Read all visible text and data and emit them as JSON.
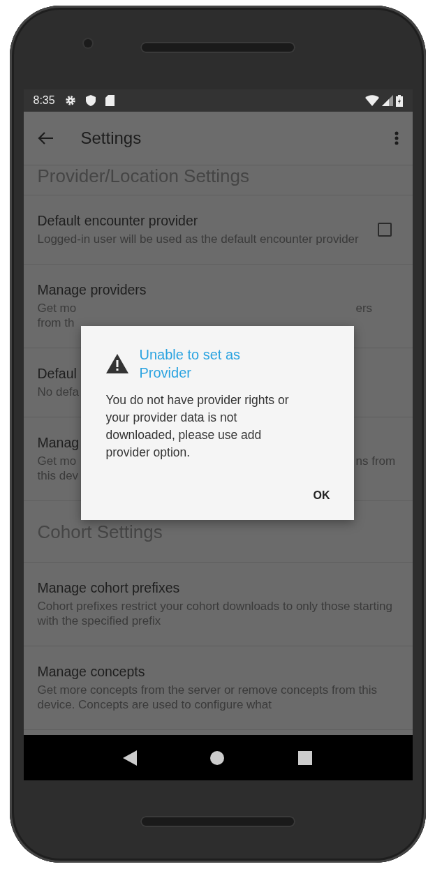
{
  "status_bar": {
    "time": "8:35"
  },
  "toolbar": {
    "title": "Settings"
  },
  "items": [
    {
      "kind": "header",
      "title": "Provider/Location Settings"
    },
    {
      "kind": "checkbox",
      "title": "Default encounter provider",
      "summary": "Logged-in user will be used as the default encounter provider",
      "checked": false
    },
    {
      "kind": "partial",
      "title": "Manage providers",
      "lines": [
        {
          "left": "Get mo",
          "right": "ers"
        },
        {
          "left": "from th"
        }
      ]
    },
    {
      "kind": "partial",
      "title": "Defaul",
      "lines": [
        {
          "left": "No defa"
        }
      ]
    },
    {
      "kind": "partial",
      "title": "Manag",
      "lines": [
        {
          "left": "Get mo",
          "right": "ns from"
        },
        {
          "left": "this dev"
        }
      ]
    },
    {
      "kind": "header",
      "title": "Cohort Settings"
    },
    {
      "kind": "text",
      "title": "Manage cohort prefixes",
      "summary": "Cohort prefixes restrict your cohort downloads to only those starting with the specified prefix"
    },
    {
      "kind": "text",
      "title": "Manage concepts",
      "summary": "Get more concepts from the server or remove concepts from this device. Concepts are used to configure what"
    }
  ],
  "dialog": {
    "title": "Unable to set as Provider",
    "message": "You do not have provider rights or your provider data is not downloaded, please use add provider option.",
    "button": "OK"
  }
}
